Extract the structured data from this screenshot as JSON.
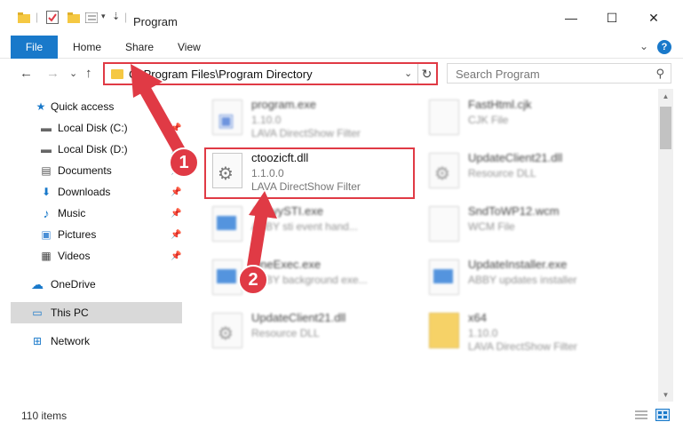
{
  "window": {
    "title": "Program",
    "minimize": "—",
    "maximize": "☐",
    "close": "✕"
  },
  "ribbon": {
    "tabs": [
      "File",
      "Home",
      "Share",
      "View"
    ],
    "expand_glyph": "⌄",
    "help_glyph": "?"
  },
  "address": {
    "path": "C:\\Program Files\\Program Directory",
    "back_glyph": "←",
    "forward_glyph": "→",
    "recent_glyph": "⌄",
    "up_glyph": "↑",
    "dropdown_glyph": "⌄",
    "refresh_glyph": "↻"
  },
  "search": {
    "placeholder": "Search Program",
    "icon_glyph": "⚲"
  },
  "navpane": {
    "items": [
      {
        "label": "Quick access",
        "icon": "star-icon",
        "glyph": "★",
        "color": "#1979ca",
        "pinned": false
      },
      {
        "label": "Local Disk (C:)",
        "icon": "drive-icon",
        "glyph": "▬",
        "color": "#666666",
        "pinned": true
      },
      {
        "label": "Local Disk (D:)",
        "icon": "drive-icon",
        "glyph": "▬",
        "color": "#666666",
        "pinned": true
      },
      {
        "label": "Documents",
        "icon": "documents-icon",
        "glyph": "▤",
        "color": "#555555",
        "pinned": true
      },
      {
        "label": "Downloads",
        "icon": "download-arrow-icon",
        "glyph": "⬇",
        "color": "#1979ca",
        "pinned": true
      },
      {
        "label": "Music",
        "icon": "music-note-icon",
        "glyph": "♪",
        "color": "#1979ca",
        "pinned": true
      },
      {
        "label": "Pictures",
        "icon": "pictures-icon",
        "glyph": "▣",
        "color": "#4a8fd6",
        "pinned": true
      },
      {
        "label": "Videos",
        "icon": "film-icon",
        "glyph": "▦",
        "color": "#444444",
        "pinned": true
      },
      {
        "label": "OneDrive",
        "icon": "cloud-icon",
        "glyph": "☁",
        "color": "#1979ca",
        "pinned": false
      },
      {
        "label": "This PC",
        "icon": "monitor-icon",
        "glyph": "▭",
        "color": "#1979ca",
        "pinned": false
      },
      {
        "label": "Network",
        "icon": "network-icon",
        "glyph": "⊞",
        "color": "#1979ca",
        "pinned": false
      }
    ],
    "pin_glyph": "📌"
  },
  "files": [
    {
      "name": "program.exe",
      "line2": "1.10.0",
      "line3": "LAVA DirectShow Filter",
      "icon": "exe-icon",
      "blurred": true
    },
    {
      "name": "FastHtml.cjk",
      "line2": "CJK File",
      "line3": "",
      "icon": "blank-file-icon",
      "blurred": true
    },
    {
      "name": "ctoozicft.dll",
      "line2": "1.1.0.0",
      "line3": "LAVA DirectShow Filter",
      "icon": "dll-gear-icon",
      "blurred": false
    },
    {
      "name": "UpdateClient21.dll",
      "line2": "Resource DLL",
      "line3": "",
      "icon": "dll-gear-icon",
      "blurred": true
    },
    {
      "name": "AbbyySTI.exe",
      "line2": "ABBY sti event hand...",
      "line3": "",
      "icon": "exe-blue-icon",
      "blurred": true
    },
    {
      "name": "SndToWP12.wcm",
      "line2": "WCM File",
      "line3": "",
      "icon": "blank-file-icon",
      "blurred": true
    },
    {
      "name": "LineExec.exe",
      "line2": "ABBY background exe...",
      "line3": "",
      "icon": "exe-blue-icon",
      "blurred": true
    },
    {
      "name": "UpdateInstaller.exe",
      "line2": "ABBY updates installer",
      "line3": "",
      "icon": "exe-blue-icon",
      "blurred": true
    },
    {
      "name": "UpdateClient21.dll",
      "line2": "Resource DLL",
      "line3": "",
      "icon": "dll-gear-icon",
      "blurred": true
    },
    {
      "name": "x64",
      "line2": "1.10.0",
      "line3": "LAVA DirectShow Filter",
      "icon": "folder-icon",
      "blurred": true
    }
  ],
  "status": {
    "item_count": "110 items"
  },
  "annotations": {
    "badge1": "1",
    "badge2": "2",
    "accent": "#e03a45"
  },
  "colors": {
    "accent": "#1979ca",
    "highlight": "#e03a45"
  }
}
